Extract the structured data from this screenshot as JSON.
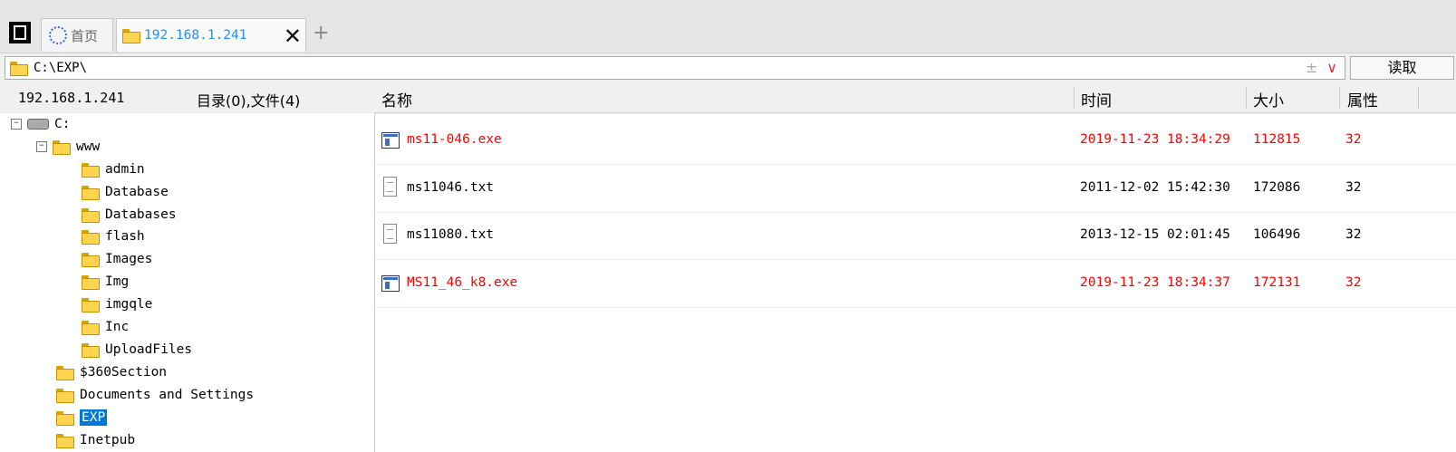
{
  "tabs": {
    "home_label": "首页",
    "active_label": "192.168.1.241",
    "close": "✕",
    "add": "+"
  },
  "address": {
    "path": "C:\\EXP\\",
    "extra_plusminus": "±",
    "extra_dropdown": "∨",
    "read_button": "读取"
  },
  "info": {
    "host": "192.168.1.241",
    "counts": "目录(0),文件(4)"
  },
  "columns": {
    "name": "名称",
    "time": "时间",
    "size": "大小",
    "attr": "属性"
  },
  "tree": [
    {
      "label": "C:",
      "type": "drive",
      "toggle": "−"
    },
    {
      "label": "www",
      "type": "folder",
      "toggle": "−"
    },
    {
      "label": "admin",
      "type": "folder"
    },
    {
      "label": "Database",
      "type": "folder"
    },
    {
      "label": "Databases",
      "type": "folder"
    },
    {
      "label": "flash",
      "type": "folder"
    },
    {
      "label": "Images",
      "type": "folder"
    },
    {
      "label": "Img",
      "type": "folder"
    },
    {
      "label": "imgqle",
      "type": "folder"
    },
    {
      "label": "Inc",
      "type": "folder"
    },
    {
      "label": "UploadFiles",
      "type": "folder"
    },
    {
      "label": "$360Section",
      "type": "folder"
    },
    {
      "label": "Documents and Settings",
      "type": "folder"
    },
    {
      "label": "EXP",
      "type": "folder",
      "selected": true
    },
    {
      "label": "Inetpub",
      "type": "folder"
    }
  ],
  "files": [
    {
      "name": "ms11-046.exe",
      "time": "2019-11-23 18:34:29",
      "size": "112815",
      "attr": "32",
      "icon": "exe-icon",
      "highlight": true
    },
    {
      "name": "ms11046.txt",
      "time": "2011-12-02 15:42:30",
      "size": "172086",
      "attr": "32",
      "icon": "text-file-icon",
      "highlight": false
    },
    {
      "name": "ms11080.txt",
      "time": "2013-12-15 02:01:45",
      "size": "106496",
      "attr": "32",
      "icon": "text-file-icon",
      "highlight": false
    },
    {
      "name": "MS11_46_k8.exe",
      "time": "2019-11-23 18:34:37",
      "size": "172131",
      "attr": "32",
      "icon": "exe-icon",
      "highlight": true
    }
  ],
  "colors": {
    "highlight_text": "#ff0000",
    "active_tab_text": "#1e90ff",
    "selection": "#0078d7"
  }
}
